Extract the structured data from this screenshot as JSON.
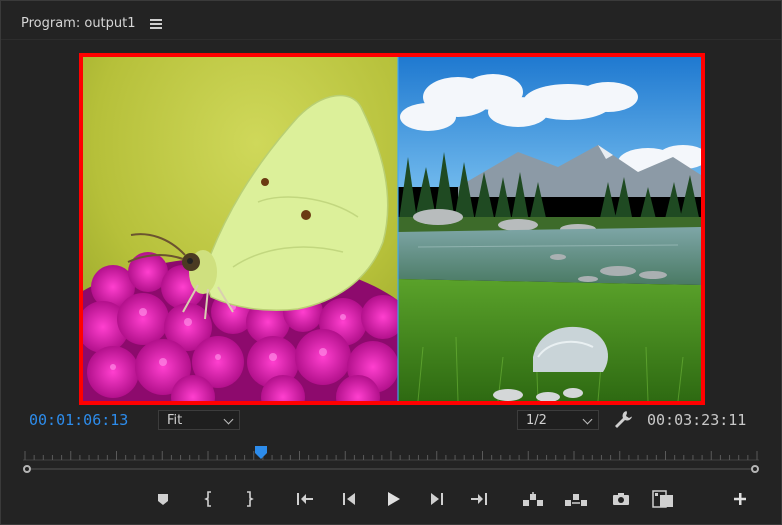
{
  "panel": {
    "title": "Program: output1",
    "menu_icon": "hamburger-menu-icon"
  },
  "monitor": {
    "border_color": "#ff0000",
    "left_image": "butterfly-on-pink-flowers",
    "right_image": "mountain-lake-landscape"
  },
  "controls": {
    "current_timecode": "00:01:06:13",
    "zoom_select": "Fit",
    "resolution_select": "1/2",
    "duration_timecode": "00:03:23:11",
    "settings_icon": "wrench-icon"
  },
  "timeline": {
    "playhead_position_fraction": 0.32,
    "accent_color": "#2d8ceb"
  },
  "transport": [
    {
      "name": "add-marker-button",
      "icon": "marker-icon"
    },
    {
      "name": "mark-in-button",
      "icon": "mark-in-icon"
    },
    {
      "name": "mark-out-button",
      "icon": "mark-out-icon"
    },
    {
      "name": "go-to-in-button",
      "icon": "go-to-in-icon"
    },
    {
      "name": "step-back-button",
      "icon": "step-back-icon"
    },
    {
      "name": "play-button",
      "icon": "play-icon"
    },
    {
      "name": "step-forward-button",
      "icon": "step-forward-icon"
    },
    {
      "name": "go-to-out-button",
      "icon": "go-to-out-icon"
    },
    {
      "name": "lift-button",
      "icon": "lift-icon"
    },
    {
      "name": "extract-button",
      "icon": "extract-icon"
    },
    {
      "name": "export-frame-button",
      "icon": "camera-icon"
    },
    {
      "name": "comparison-view-button",
      "icon": "comparison-view-icon"
    },
    {
      "name": "button-editor-button",
      "icon": "plus-icon"
    }
  ]
}
